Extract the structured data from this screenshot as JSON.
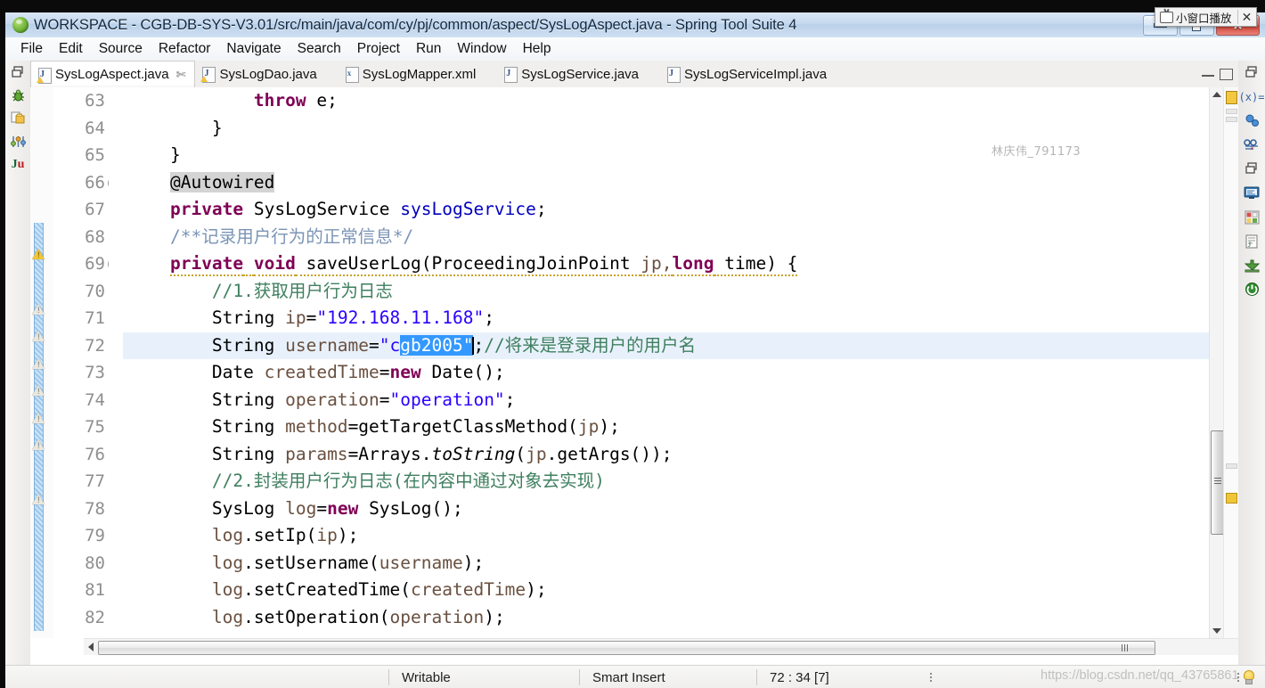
{
  "window": {
    "title": "WORKSPACE - CGB-DB-SYS-V3.01/src/main/java/com/cy/pj/common/aspect/SysLogAspect.java - Spring Tool Suite 4",
    "app_icon": "spring-leaf-icon",
    "buttons": {
      "minimize": "minimize-icon",
      "restore": "restore-icon",
      "close": "×"
    }
  },
  "mini_player": {
    "label": "小窗口播放",
    "close": "✕",
    "icon": "tv-icon"
  },
  "menu": {
    "items": [
      "File",
      "Edit",
      "Source",
      "Refactor",
      "Navigate",
      "Search",
      "Project",
      "Run",
      "Window",
      "Help"
    ]
  },
  "left_toolbar": {
    "items": [
      "restore-view-icon",
      "debug-bug-icon",
      "package-explorer-icon",
      "settings-sliders-icon",
      "junit-icon"
    ]
  },
  "right_toolbar": {
    "items": [
      "restore-view-icon",
      "variables-icon",
      "breakpoints-icon",
      "expressions-icon",
      "minimize-view-icon",
      "console-icon",
      "servers-icon",
      "junit-view-icon",
      "install-icon",
      "power-icon"
    ]
  },
  "tabs": [
    {
      "label": "SysLogAspect.java",
      "icon": "java-file-warning-icon",
      "active": true,
      "closable": true,
      "close_glyph": "✄"
    },
    {
      "label": "SysLogDao.java",
      "icon": "java-file-warning-icon",
      "active": false,
      "closable": false
    },
    {
      "label": "SysLogMapper.xml",
      "icon": "xml-file-icon",
      "active": false,
      "closable": false
    },
    {
      "label": "SysLogService.java",
      "icon": "java-file-icon",
      "active": false,
      "closable": false
    },
    {
      "label": "SysLogServiceImpl.java",
      "icon": "java-file-icon",
      "active": false,
      "closable": false
    }
  ],
  "editor": {
    "first_line": 63,
    "current_line": 72,
    "lines": [
      {
        "num": "63",
        "fold": false,
        "marker": "none",
        "changed": false
      },
      {
        "num": "64",
        "fold": false,
        "marker": "none",
        "changed": false
      },
      {
        "num": "65",
        "fold": false,
        "marker": "none",
        "changed": false
      },
      {
        "num": "66",
        "fold": true,
        "marker": "none",
        "changed": false
      },
      {
        "num": "67",
        "fold": false,
        "marker": "none",
        "changed": false
      },
      {
        "num": "68",
        "fold": false,
        "marker": "none",
        "changed": true
      },
      {
        "num": "69",
        "fold": true,
        "marker": "warning-gold",
        "changed": true
      },
      {
        "num": "70",
        "fold": false,
        "marker": "none",
        "changed": true
      },
      {
        "num": "71",
        "fold": false,
        "marker": "warning",
        "changed": true
      },
      {
        "num": "72",
        "fold": false,
        "marker": "warning",
        "changed": true
      },
      {
        "num": "73",
        "fold": false,
        "marker": "warning",
        "changed": true
      },
      {
        "num": "74",
        "fold": false,
        "marker": "warning",
        "changed": true
      },
      {
        "num": "75",
        "fold": false,
        "marker": "warning",
        "changed": true
      },
      {
        "num": "76",
        "fold": false,
        "marker": "warning",
        "changed": true
      },
      {
        "num": "77",
        "fold": false,
        "marker": "none",
        "changed": true
      },
      {
        "num": "78",
        "fold": false,
        "marker": "warning",
        "changed": true
      },
      {
        "num": "79",
        "fold": false,
        "marker": "none",
        "changed": true
      },
      {
        "num": "80",
        "fold": false,
        "marker": "none",
        "changed": true
      },
      {
        "num": "81",
        "fold": false,
        "marker": "none",
        "changed": true
      },
      {
        "num": "82",
        "fold": false,
        "marker": "none",
        "changed": true
      }
    ],
    "code": {
      "l63_throw": "throw",
      "l63_rest": " e;",
      "l64": "        }",
      "l65": "    }",
      "l66_at": "@Autowired",
      "l67_private": "private",
      "l67_type": " SysLogService ",
      "l67_field": "sysLogService",
      "l67_end": ";",
      "l68_comment": "/**记录用户行为的正常信息*/",
      "l69_private": "private",
      "l69_void": "void",
      "l69_name": " saveUserLog(ProceedingJoinPoint ",
      "l69_jp": "jp,",
      "l69_long": "long",
      "l69_time": " time) {",
      "l70_comment": "//1.获取用户行为日志",
      "l71_pre": "String ",
      "l71_var": "ip",
      "l71_eq": "=",
      "l71_str": "\"192.168.11.168\"",
      "l71_end": ";",
      "l72_pre": "String ",
      "l72_var": "username",
      "l72_eq": "=",
      "l72_str_head": "\"c",
      "l72_str_sel": "gb2005\"",
      "l72_end": ";",
      "l72_comment": "//将来是登录用户的用户名",
      "l73_pre": "Date ",
      "l73_var": "createdTime",
      "l73_eq": "=",
      "l73_new": "new",
      "l73_end": " Date();",
      "l74_pre": "String ",
      "l74_var": "operation",
      "l74_eq": "=",
      "l74_str": "\"operation\"",
      "l74_end": ";",
      "l75_pre": "String ",
      "l75_var": "method",
      "l75_eq": "=getTargetClassMethod(",
      "l75_jp": "jp",
      "l75_end": ");",
      "l76_pre": "String ",
      "l76_var": "params",
      "l76_eq": "=Arrays.",
      "l76_static": "toString",
      "l76_open": "(",
      "l76_jp": "jp",
      "l76_end": ".getArgs());",
      "l77_comment": "//2.封装用户行为日志(在内容中通过对象去实现)",
      "l78_pre": "SysLog ",
      "l78_var": "log",
      "l78_eq": "=",
      "l78_new": "new",
      "l78_end": " SysLog();",
      "l79_var": "log",
      "l79_rest": ".setIp(",
      "l79_arg": "ip",
      "l79_end": ");",
      "l80_var": "log",
      "l80_rest": ".setUsername(",
      "l80_arg": "username",
      "l80_end": ");",
      "l81_var": "log",
      "l81_rest": ".setCreatedTime(",
      "l81_arg": "createdTime",
      "l81_end": ");",
      "l82_var": "log",
      "l82_rest": ".setOperation(",
      "l82_arg": "operation",
      "l82_end": ");"
    }
  },
  "status_bar": {
    "writable": "Writable",
    "insert_mode": "Smart Insert",
    "cursor_position": "72 : 34 [7]",
    "bulb": "quick-fix-bulb-icon"
  },
  "watermarks": {
    "user": "林庆伟_791173",
    "url": "https://blog.csdn.net/qq_43765861"
  },
  "colors": {
    "keyword": "#7f0055",
    "string": "#2a00ff",
    "comment": "#3f7f5f",
    "javadoc": "#7a94b5",
    "field": "#0000c0",
    "local_var": "#6a5040",
    "selection": "#3399ff",
    "current_line": "#e8f1fb",
    "occurrence_highlight": "#d4d4d4",
    "titlebar": "#c6d9ef"
  }
}
